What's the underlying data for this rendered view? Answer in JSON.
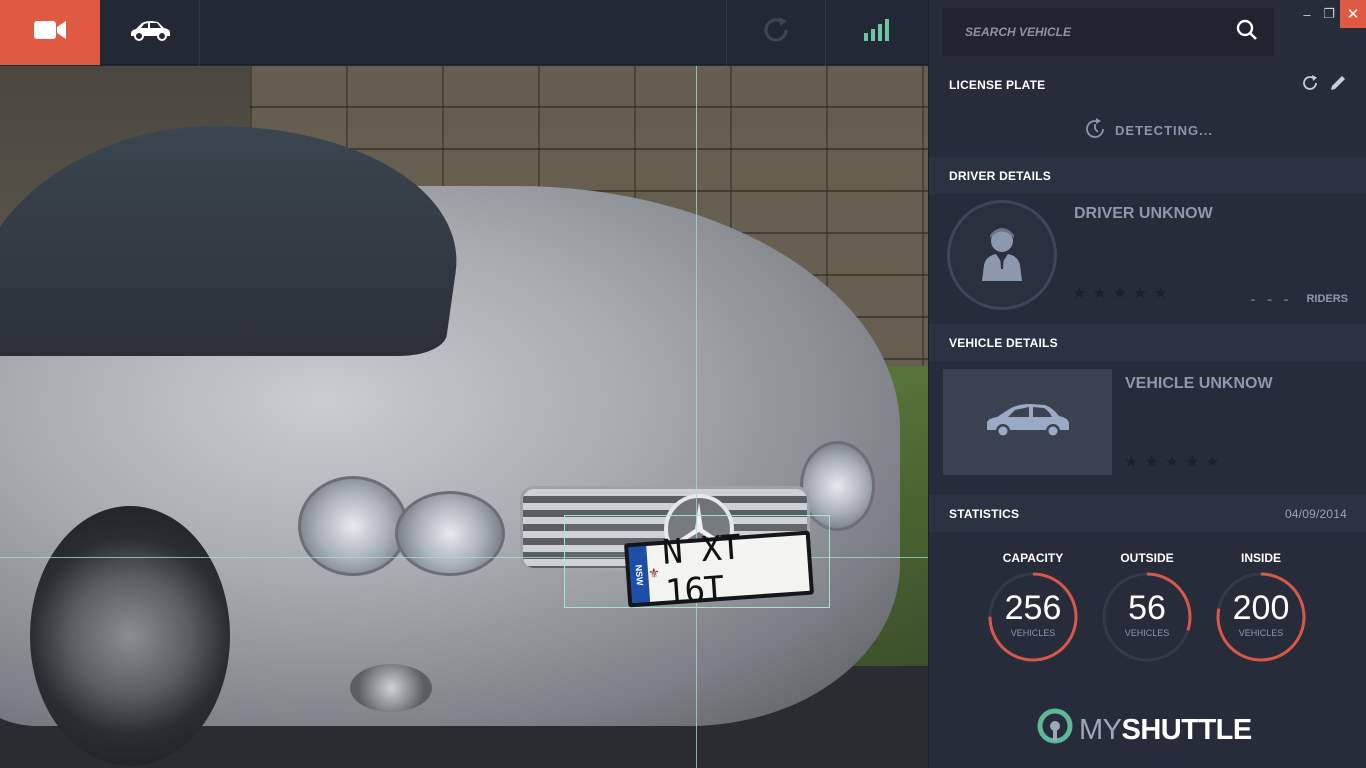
{
  "toolbar": {
    "buttons": [
      {
        "icon": "video-camera-icon",
        "active": true
      },
      {
        "icon": "car-icon"
      },
      {
        "icon": "refresh-icon"
      },
      {
        "icon": "signal-bars-icon"
      }
    ],
    "accent_color": "#e05a43"
  },
  "camera": {
    "plate": {
      "state": "NSW",
      "text": "N XT 16T"
    }
  },
  "search": {
    "placeholder": "SEARCH VEHICLE"
  },
  "window": {
    "minimize": "–",
    "restore": "❐",
    "close": "✕"
  },
  "license_plate": {
    "title": "LICENSE PLATE",
    "status": "DETECTING..."
  },
  "driver": {
    "title": "DRIVER DETAILS",
    "name": "DRIVER UNKNOW",
    "rating": 0,
    "riders_value": "- - -",
    "riders_label": "RIDERS"
  },
  "vehicle": {
    "title": "VEHICLE DETAILS",
    "name": "VEHICLE UNKNOW",
    "rating": 0
  },
  "statistics": {
    "title": "STATISTICS",
    "date": "04/09/2014",
    "items": [
      {
        "label": "CAPACITY",
        "value": "256",
        "unit": "VEHICLES",
        "fill": 0.75
      },
      {
        "label": "OUTSIDE",
        "value": "56",
        "unit": "VEHICLES",
        "fill": 0.3
      },
      {
        "label": "INSIDE",
        "value": "200",
        "unit": "VEHICLES",
        "fill": 0.78
      }
    ],
    "ring_color": "#d9574a"
  },
  "brand": {
    "my": "MY",
    "shuttle": "SHUTTLE"
  }
}
